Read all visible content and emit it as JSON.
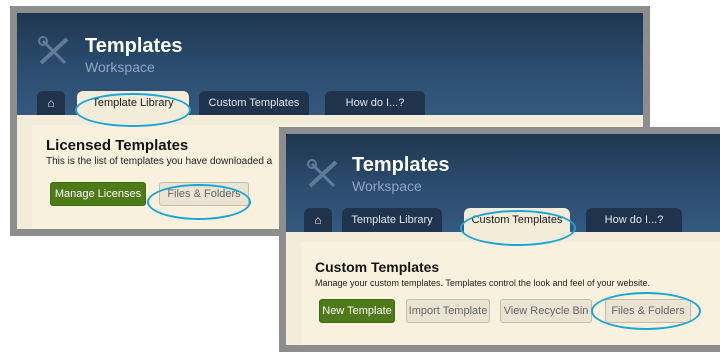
{
  "shot1": {
    "title": "Templates",
    "subtitle": "Workspace",
    "tabs": {
      "home": "⌂",
      "template_library": "Template Library",
      "custom_templates": "Custom Templates",
      "how_do_i": "How do I...?"
    },
    "active_tab": "Template Library",
    "section_title": "Licensed Templates",
    "section_desc": "This is the list of templates you have downloaded a",
    "buttons": {
      "manage_licenses": "Manage Licenses",
      "files_folders": "Files & Folders"
    }
  },
  "shot2": {
    "title": "Templates",
    "subtitle": "Workspace",
    "tabs": {
      "home": "⌂",
      "template_library": "Template Library",
      "custom_templates": "Custom Templates",
      "how_do_i": "How do I...?"
    },
    "active_tab": "Custom Templates",
    "section_title": "Custom Templates",
    "section_desc": "Manage your custom templates. Templates control the look and feel of your website.",
    "buttons": {
      "new_template": "New Template",
      "import_template": "Import Template",
      "view_recycle_bin": "View Recycle Bin",
      "files_folders": "Files & Folders"
    }
  },
  "icons": {
    "logo": "templates-logo-icon",
    "home": "home-icon"
  },
  "colors": {
    "header": "#2b4d70",
    "tab_inactive": "#1f344c",
    "content_bg": "#f3ecd9",
    "primary_button": "#4e7a19",
    "highlight_ring": "#18a6d6"
  }
}
